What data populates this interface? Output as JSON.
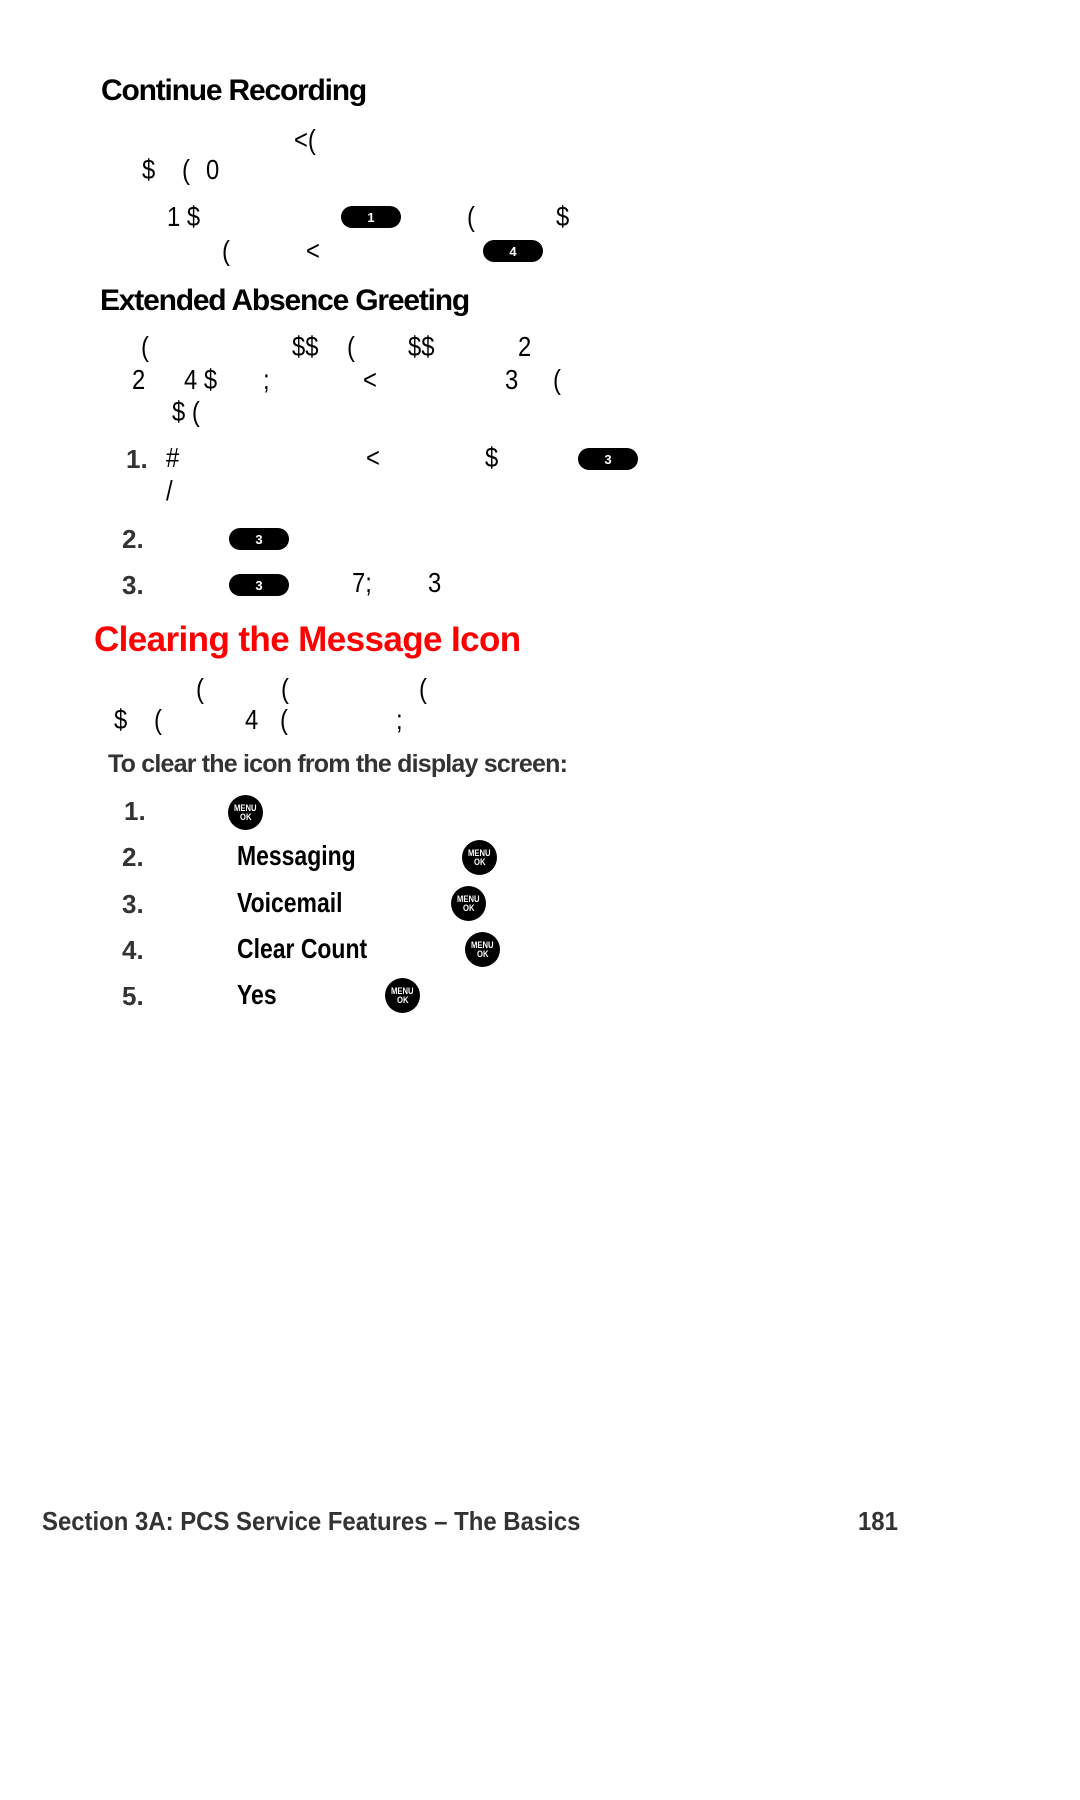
{
  "sections": {
    "continue_recording": {
      "heading": "Continue Recording",
      "line1": [
        "<(",
        "$",
        "(",
        "0"
      ],
      "line2_prefix": "1 $",
      "key_1": "1",
      "line2_after_key": [
        "(",
        "$"
      ],
      "line3": [
        "(",
        "<"
      ],
      "key_4": "4"
    },
    "extended_absence": {
      "heading": "Extended Absence Greeting",
      "para_line1": [
        "(",
        "$$",
        "(",
        "$$",
        "2"
      ],
      "para_line2": [
        "2",
        "4 $",
        ";",
        "<",
        "3",
        "("
      ],
      "para_line3": [
        "$ ("
      ],
      "steps": [
        {
          "number": "1.",
          "glyphs": [
            "#",
            "<",
            "$"
          ],
          "key": "3",
          "cont": "/"
        },
        {
          "number": "2.",
          "key": "3"
        },
        {
          "number": "3.",
          "key": "3",
          "after": [
            "7;",
            "3"
          ]
        }
      ]
    },
    "clearing_icon": {
      "heading": "Clearing the Message Icon",
      "para_line1": [
        "(",
        "(",
        "("
      ],
      "para_line2": [
        "$",
        "(",
        "4",
        "(",
        ";"
      ],
      "subheading": "To clear the icon from the display screen:",
      "steps": [
        {
          "number": "1.",
          "label": "",
          "key": "MENU OK"
        },
        {
          "number": "2.",
          "label": "Messaging",
          "key": "MENU OK"
        },
        {
          "number": "3.",
          "label": "Voicemail",
          "key": "MENU OK"
        },
        {
          "number": "4.",
          "label": "Clear Count",
          "key": "MENU OK"
        },
        {
          "number": "5.",
          "label": "Yes",
          "key": "MENU OK"
        }
      ]
    }
  },
  "menu_key": {
    "top": "MENU",
    "bottom": "OK"
  },
  "footer": {
    "section_title": "Section 3A: PCS Service Features – The Basics",
    "page_number": "181"
  },
  "colors": {
    "heading_red": "#ff0000",
    "step_gray": "#333333"
  }
}
